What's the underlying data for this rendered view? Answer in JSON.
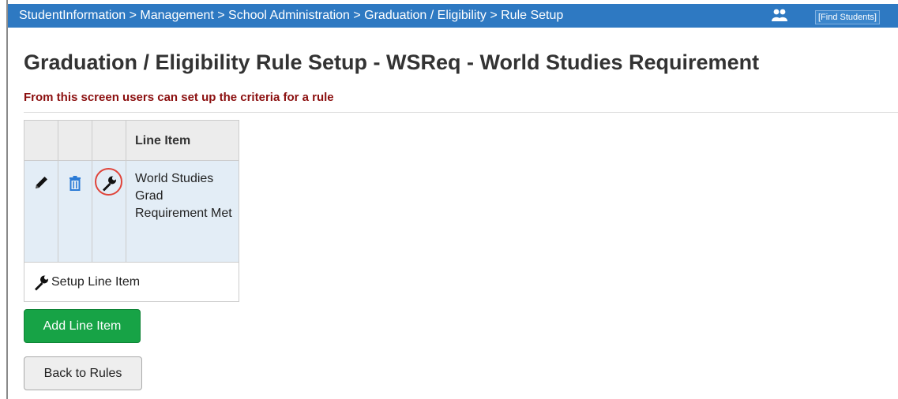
{
  "header": {
    "breadcrumb": "StudentInformation > Management > School Administration > Graduation / Eligibility > Rule Setup",
    "find_students_placeholder": "[Find Students]"
  },
  "page": {
    "title": "Graduation / Eligibility Rule Setup - WSReq - World Studies Requirement",
    "subtitle": "From this screen users can set up the criteria for a rule"
  },
  "grid": {
    "column_header": "Line Item",
    "rows": [
      {
        "line_item": "World Studies Grad Requirement Met",
        "icons": [
          "pencil-icon",
          "trash-icon",
          "wrench-icon"
        ]
      }
    ],
    "footer_label": "Setup Line Item"
  },
  "buttons": {
    "add_line_item": "Add Line Item",
    "back_to_rules": "Back to Rules"
  },
  "colors": {
    "header_bar": "#2e79c2",
    "subtitle": "#8b0f0f",
    "add_button": "#17a346",
    "row_highlight": "#e3edf6",
    "circle_highlight": "#e0443a"
  }
}
